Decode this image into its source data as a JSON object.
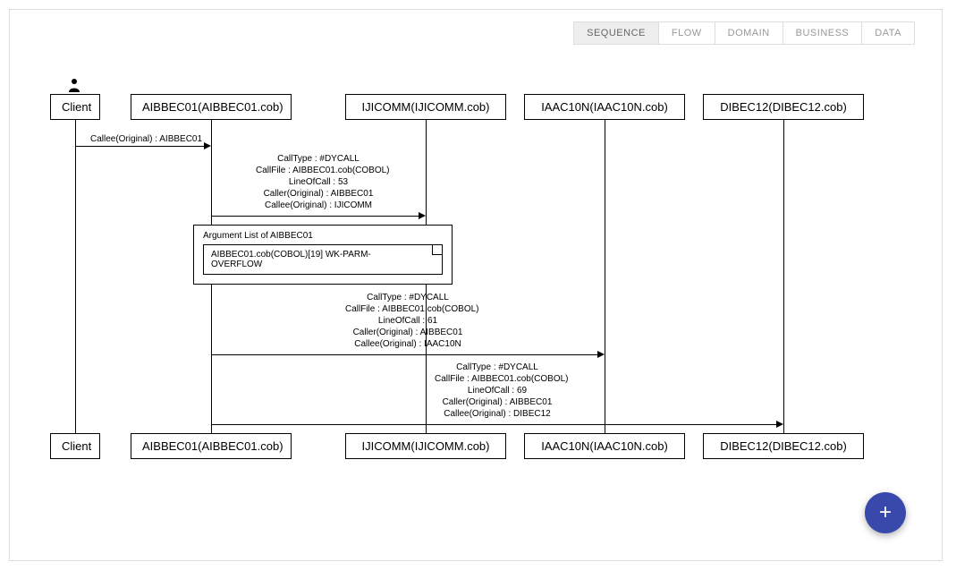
{
  "tabs": {
    "sequence": "SEQUENCE",
    "flow": "FLOW",
    "domain": "DOMAIN",
    "business": "BUSINESS",
    "data": "DATA"
  },
  "participants": {
    "client": "Client",
    "aibbec01": "AIBBEC01(AIBBEC01.cob)",
    "ijicomm": "IJICOMM(IJICOMM.cob)",
    "iaac10n": "IAAC10N(IAAC10N.cob)",
    "dibec12": "DIBEC12(DIBEC12.cob)"
  },
  "messages": {
    "m1": "Callee(Original) : AIBBEC01",
    "m2_l1": "CallType : #DYCALL",
    "m2_l2": "CallFile : AIBBEC01.cob(COBOL)",
    "m2_l3": "LineOfCall : 53",
    "m2_l4": "Caller(Original) : AIBBEC01",
    "m2_l5": "Callee(Original) : IJICOMM",
    "m3_l1": "CallType : #DYCALL",
    "m3_l2": "CallFile : AIBBEC01.cob(COBOL)",
    "m3_l3": "LineOfCall : 61",
    "m3_l4": "Caller(Original) : AIBBEC01",
    "m3_l5": "Callee(Original) : IAAC10N",
    "m4_l1": "CallType : #DYCALL",
    "m4_l2": "CallFile : AIBBEC01.cob(COBOL)",
    "m4_l3": "LineOfCall : 69",
    "m4_l4": "Caller(Original) : AIBBEC01",
    "m4_l5": "Callee(Original) : DIBEC12"
  },
  "note": {
    "title": "Argument List of AIBBEC01",
    "content": "AIBBEC01.cob(COBOL)[19] WK-PARM-OVERFLOW"
  },
  "fab": "+"
}
